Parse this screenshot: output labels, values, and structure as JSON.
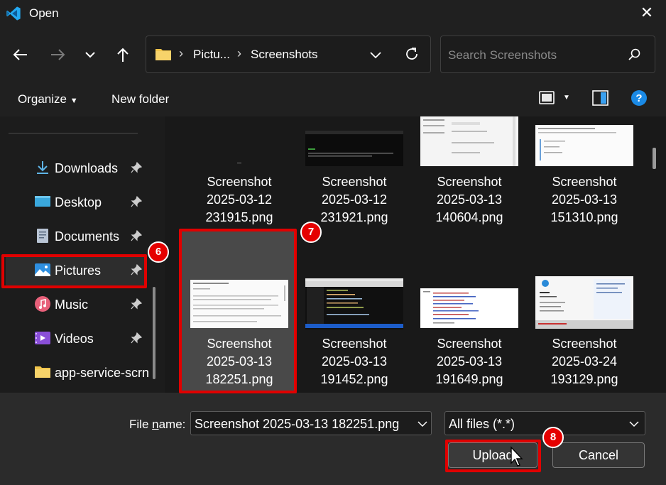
{
  "window": {
    "title": "Open"
  },
  "address": {
    "crumbs": [
      "Pictu...",
      "Screenshots"
    ],
    "search_placeholder": "Search Screenshots"
  },
  "toolbar": {
    "organize": "Organize",
    "new_folder": "New folder"
  },
  "sidebar": {
    "items": [
      {
        "label": "Downloads",
        "icon": "download-icon",
        "pinned": true
      },
      {
        "label": "Desktop",
        "icon": "desktop-icon",
        "pinned": true
      },
      {
        "label": "Documents",
        "icon": "documents-icon",
        "pinned": true
      },
      {
        "label": "Pictures",
        "icon": "pictures-icon",
        "pinned": true,
        "selected": true
      },
      {
        "label": "Music",
        "icon": "music-icon",
        "pinned": true
      },
      {
        "label": "Videos",
        "icon": "videos-icon",
        "pinned": true
      },
      {
        "label": "app-service-scrn",
        "icon": "folder-icon",
        "pinned": false
      }
    ]
  },
  "files": [
    {
      "line1": "Screenshot",
      "line2": "2025-03-12",
      "line3": "231915.png"
    },
    {
      "line1": "Screenshot",
      "line2": "2025-03-12",
      "line3": "231921.png"
    },
    {
      "line1": "Screenshot",
      "line2": "2025-03-13",
      "line3": "140604.png"
    },
    {
      "line1": "Screenshot",
      "line2": "2025-03-13",
      "line3": "151310.png"
    },
    {
      "line1": "Screenshot",
      "line2": "2025-03-13",
      "line3": "182251.png",
      "selected": true
    },
    {
      "line1": "Screenshot",
      "line2": "2025-03-13",
      "line3": "191452.png"
    },
    {
      "line1": "Screenshot",
      "line2": "2025-03-13",
      "line3": "191649.png"
    },
    {
      "line1": "Screenshot",
      "line2": "2025-03-24",
      "line3": "193129.png"
    }
  ],
  "footer": {
    "file_name_label_pre": "File ",
    "file_name_label_u": "n",
    "file_name_label_post": "ame:",
    "file_name_value": "Screenshot 2025-03-13 182251.png",
    "file_type_value": "All files (*.*)",
    "upload_label": "Upload",
    "cancel_label": "Cancel"
  },
  "annotations": {
    "badge_6": "6",
    "badge_7": "7",
    "badge_8": "8"
  },
  "colors": {
    "highlight": "#e00000",
    "background": "#202020",
    "accent": "#0078d4"
  }
}
